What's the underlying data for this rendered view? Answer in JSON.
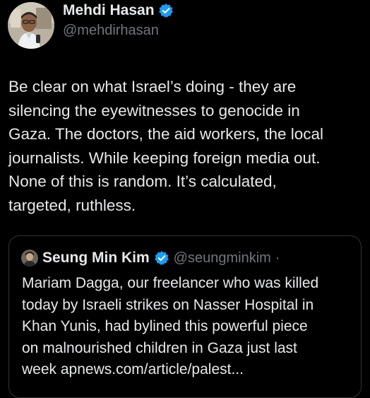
{
  "author": {
    "display_name": "Mehdi Hasan",
    "handle": "@mehdirhasan",
    "verified_icon": "verified-badge-icon",
    "avatar_icon": "profile-photo"
  },
  "tweet": {
    "text": "Be clear on what Israel’s doing - they are\nsilencing the eyewitnesses to genocide in\nGaza. The doctors, the aid workers, the local\njournalists. While keeping foreign media out.\nNone of this is random. It’s calculated,\ntargeted, ruthless."
  },
  "quoted": {
    "display_name": "Seung Min Kim",
    "handle": "@seungminkim",
    "separator": "·",
    "verified_icon": "verified-badge-icon",
    "text": "Mariam Dagga, our freelancer who was killed\ntoday by Israeli strikes on Nasser Hospital in\nKhan Yunis, had bylined this powerful piece\non malnourished children in Gaza just last\nweek apnews.com/article/palest..."
  },
  "colors": {
    "background": "#000000",
    "text_primary": "#e7e9ea",
    "text_secondary": "#71767b",
    "verified_blue": "#1d9bf0",
    "border": "#2f3336"
  }
}
